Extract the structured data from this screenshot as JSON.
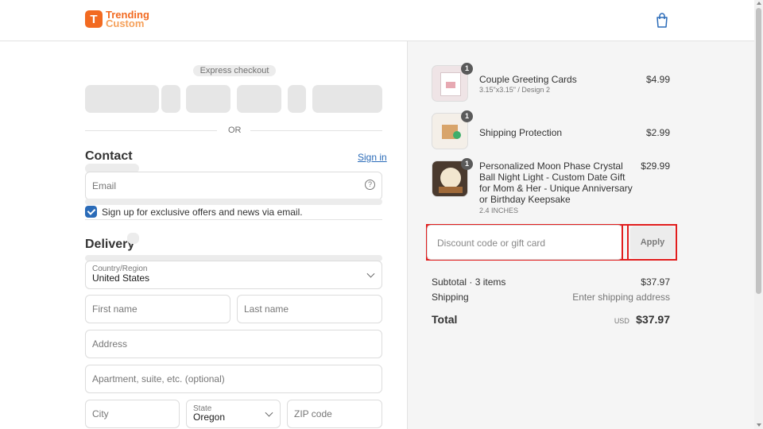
{
  "header": {
    "brand_line1": "Trending",
    "brand_line2": "Custom",
    "logo_glyph": "T",
    "cart_icon": "shopping-bag-icon",
    "accent": "#f26a21"
  },
  "checkout": {
    "express_label": "Express checkout",
    "or_label": "OR",
    "contact_title": "Contact",
    "sign_in": "Sign in",
    "email_placeholder": "Email",
    "help_glyph": "?",
    "newsletter_label": "Sign up for exclusive offers and news via email.",
    "newsletter_checked": true,
    "delivery_title": "Delivery",
    "country_label": "Country/Region",
    "country_value": "United States",
    "first_name_placeholder": "First name",
    "last_name_placeholder": "Last name",
    "address_placeholder": "Address",
    "apartment_placeholder": "Apartment, suite, etc. (optional)",
    "city_placeholder": "City",
    "state_label": "State",
    "state_value": "Oregon",
    "zip_placeholder": "ZIP code"
  },
  "summary": {
    "items": [
      {
        "qty": "1",
        "name": "Couple Greeting Cards",
        "variant": "3.15\"x3.15\" / Design 2",
        "price": "$4.99"
      },
      {
        "qty": "1",
        "name": "Shipping Protection",
        "variant": "",
        "price": "$2.99"
      },
      {
        "qty": "1",
        "name": "Personalized Moon Phase Crystal Ball Night Light - Custom Date Gift for Mom & Her - Unique Anniversary or Birthday Keepsake",
        "variant": "2.4 INCHES",
        "price": "$29.99"
      }
    ],
    "discount_placeholder": "Discount code or gift card",
    "apply_label": "Apply",
    "subtotal_label": "Subtotal · 3 items",
    "subtotal_value": "$37.97",
    "shipping_label": "Shipping",
    "shipping_value": "Enter shipping address",
    "total_label": "Total",
    "currency": "USD",
    "total_value": "$37.97",
    "highlight_color": "#e11d1d",
    "link_color": "#2a6bb8"
  }
}
